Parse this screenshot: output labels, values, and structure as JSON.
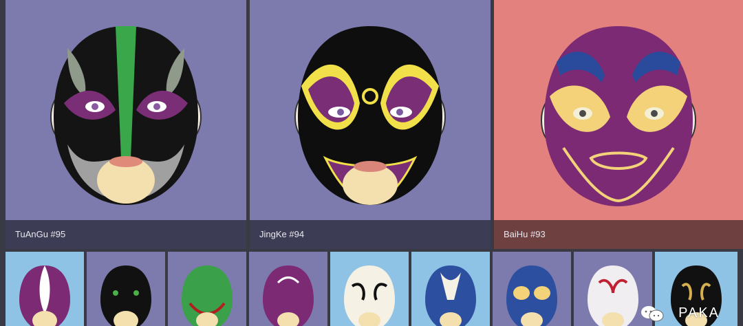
{
  "cards": [
    {
      "caption": "TuAnGu #95",
      "bg": "#7d7aae",
      "capbg": "#3d3c55",
      "mask": "tuangu"
    },
    {
      "caption": "JingKe #94",
      "bg": "#7d7aae",
      "capbg": "#3d3c55",
      "mask": "jingke"
    },
    {
      "caption": "BaiHu #93",
      "bg": "#e3817f",
      "capbg": "#6e4040",
      "mask": "baihu"
    }
  ],
  "thumbnails": [
    {
      "bg": "#8fc3e6",
      "mask": "purple-white"
    },
    {
      "bg": "#7d7aae",
      "mask": "black-green"
    },
    {
      "bg": "#7d7aae",
      "mask": "green-red"
    },
    {
      "bg": "#7d7aae",
      "mask": "purple-swirl"
    },
    {
      "bg": "#8fc3e6",
      "mask": "white-black"
    },
    {
      "bg": "#8fc3e6",
      "mask": "blue-white"
    },
    {
      "bg": "#7d7aae",
      "mask": "blue-yellow"
    },
    {
      "bg": "#7d7aae",
      "mask": "white-red"
    },
    {
      "bg": "#8fc3e6",
      "mask": "black-gold"
    }
  ],
  "watermark": {
    "text": "PAKA",
    "icon": "chat-bubbles-icon"
  }
}
